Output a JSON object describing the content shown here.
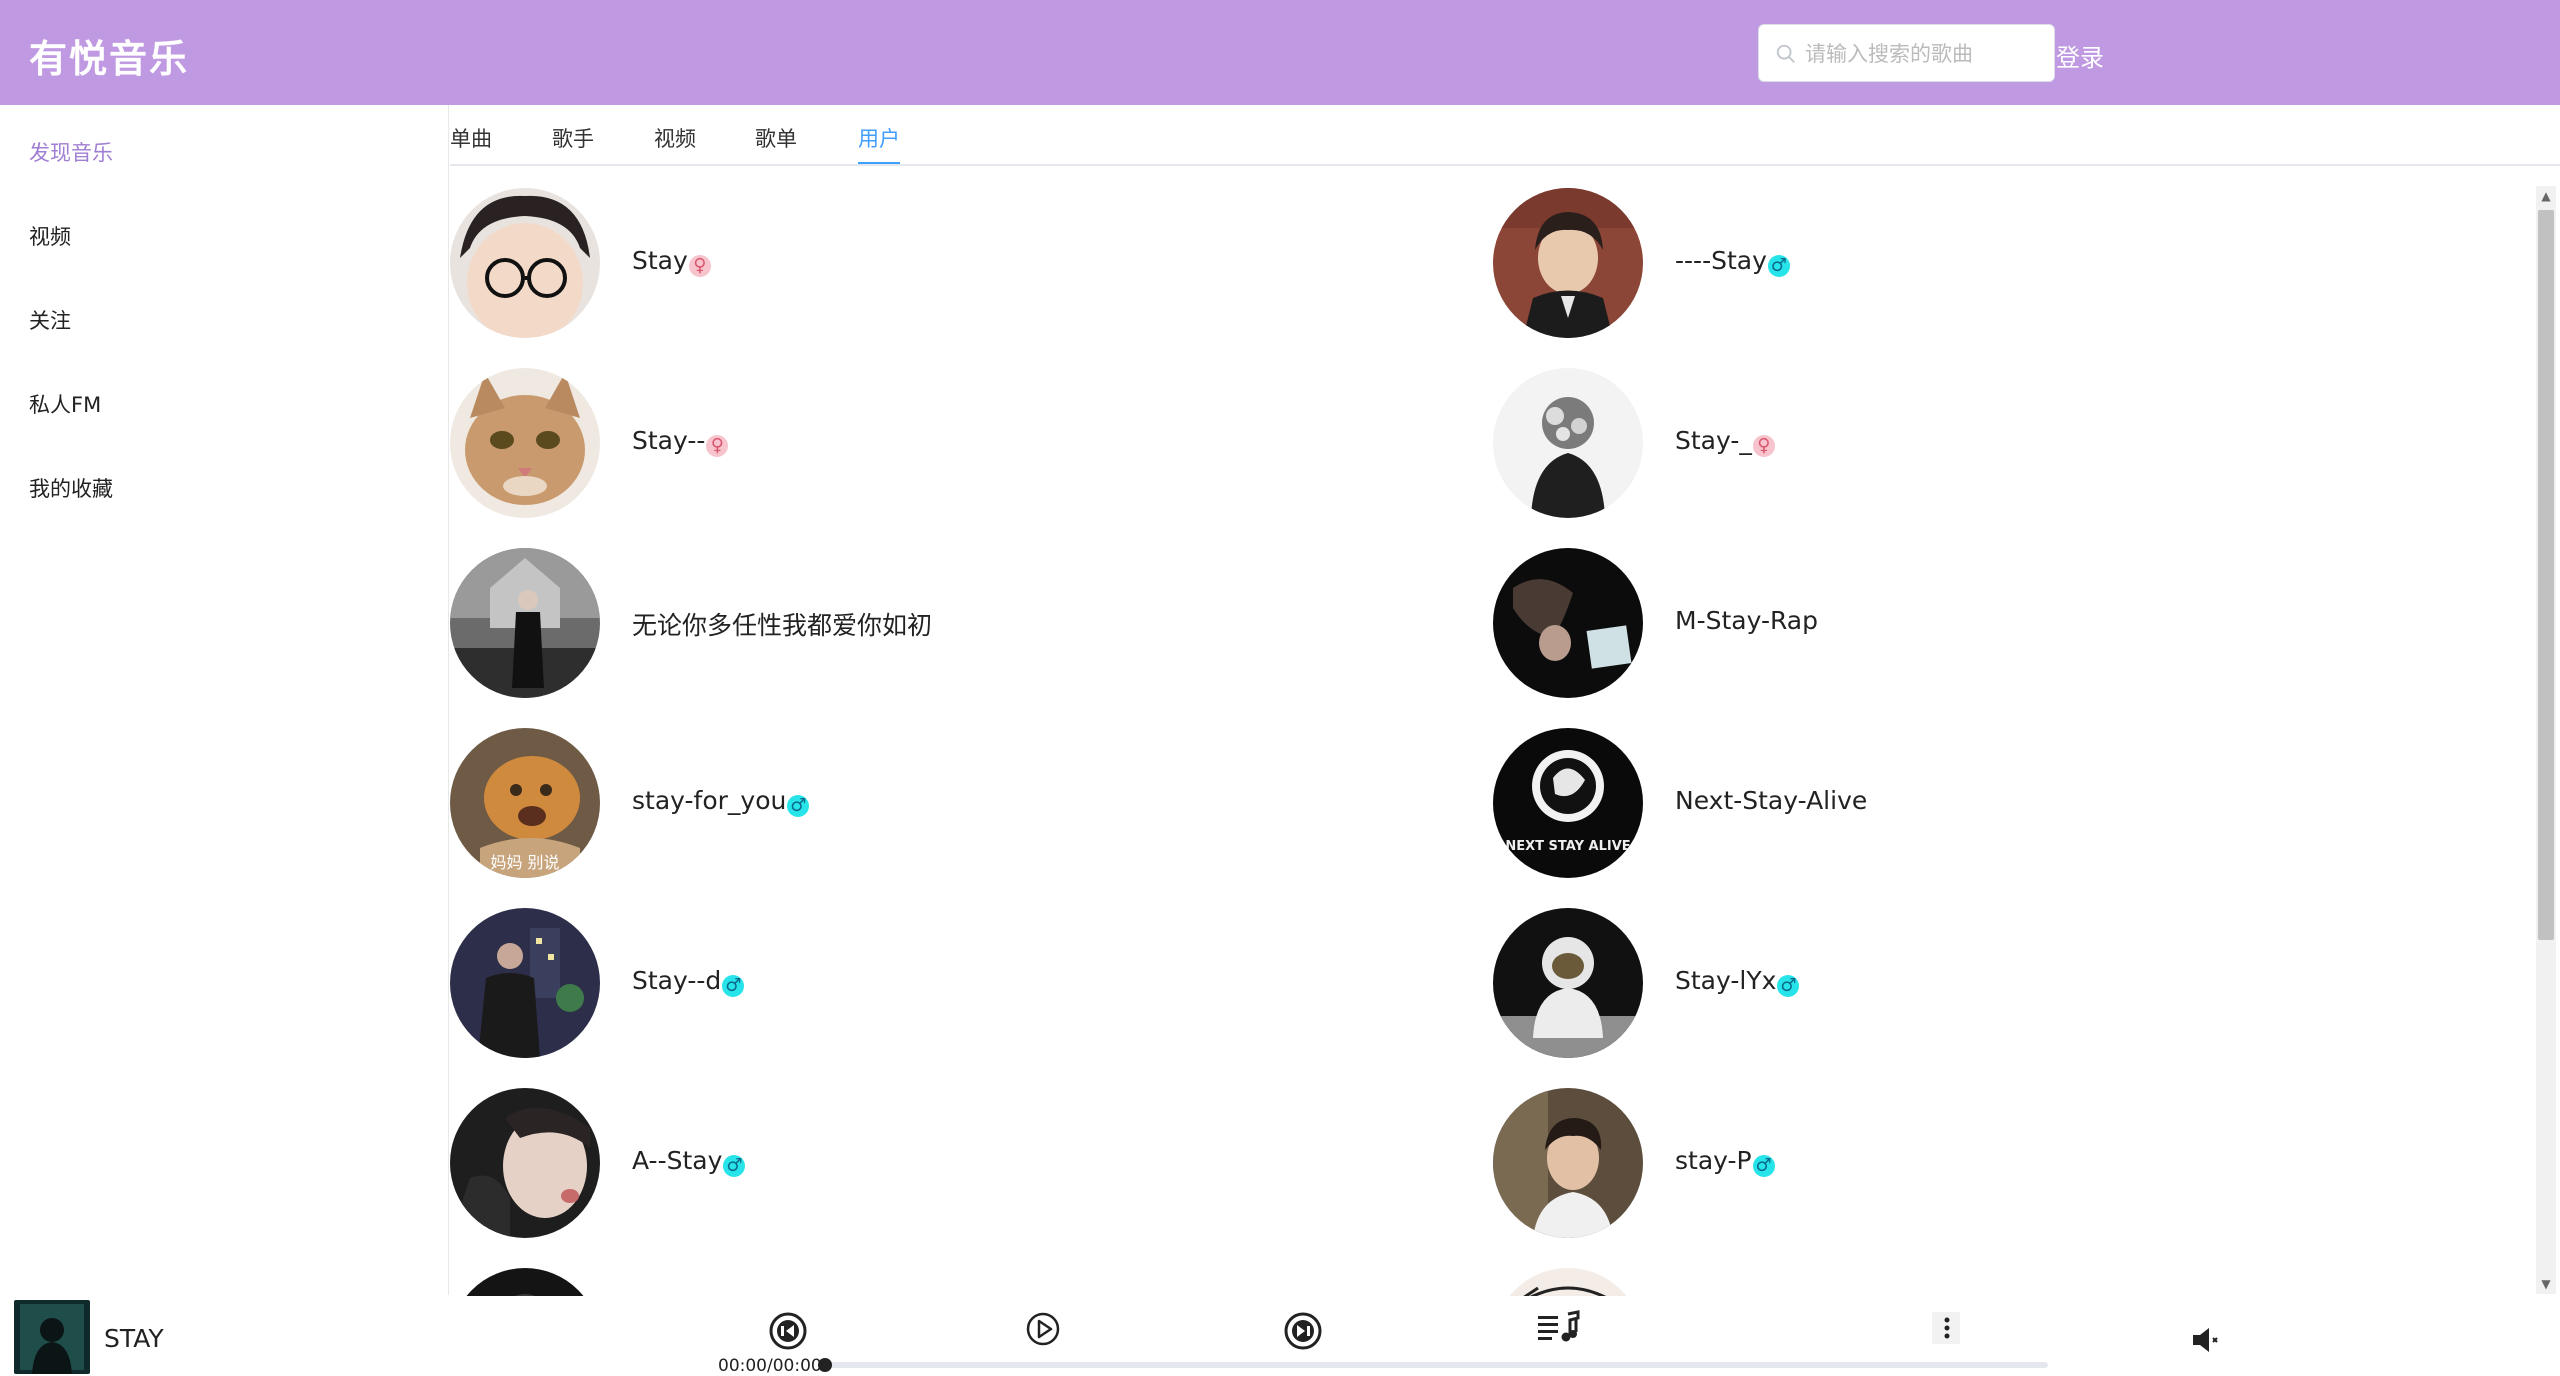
{
  "header": {
    "brand": "有悦音乐",
    "search_placeholder": "请输入搜索的歌曲",
    "search_value": "",
    "login_label": "登录",
    "bg_color": "#bf99e1"
  },
  "sidebar": {
    "items": [
      {
        "label": "发现音乐",
        "active": true
      },
      {
        "label": "视频",
        "active": false
      },
      {
        "label": "关注",
        "active": false
      },
      {
        "label": "私人FM",
        "active": false
      },
      {
        "label": "我的收藏",
        "active": false
      }
    ],
    "active_color": "#a07ed3"
  },
  "tabs": {
    "items": [
      "单曲",
      "歌手",
      "视频",
      "歌单",
      "用户"
    ],
    "active_index": 4,
    "active_color": "#409eff"
  },
  "users": [
    {
      "name": "Stay",
      "gender": "female",
      "gender_symbol": "♀"
    },
    {
      "name": "----Stay",
      "gender": "male",
      "gender_symbol": "♂"
    },
    {
      "name": "Stay--",
      "gender": "female",
      "gender_symbol": "♀"
    },
    {
      "name": "Stay-_",
      "gender": "female",
      "gender_symbol": "♀"
    },
    {
      "name": "无论你多任性我都爱你如初",
      "gender": "none",
      "gender_symbol": ""
    },
    {
      "name": "M-Stay-Rap",
      "gender": "none",
      "gender_symbol": ""
    },
    {
      "name": "stay-for_you",
      "gender": "male",
      "gender_symbol": "♂"
    },
    {
      "name": "Next-Stay-Alive",
      "gender": "none",
      "gender_symbol": ""
    },
    {
      "name": "Stay--d",
      "gender": "male",
      "gender_symbol": "♂"
    },
    {
      "name": "Stay-lYx",
      "gender": "male",
      "gender_symbol": "♂"
    },
    {
      "name": "A--Stay",
      "gender": "male",
      "gender_symbol": "♂"
    },
    {
      "name": "stay-P",
      "gender": "male",
      "gender_symbol": "♂"
    }
  ],
  "avatar_overlay_texts": {
    "cat_caption": "妈妈 别说",
    "alive_caption": "NEXT STAY ALIVE"
  },
  "player": {
    "song_title": "STAY",
    "time_display": "00:00/00:00",
    "progress": 0.0,
    "icons": {
      "prev": "prev-track-icon",
      "play": "play-icon",
      "next": "next-track-icon",
      "playlist": "playlist-icon",
      "more": "more-vertical-icon",
      "volume": "volume-mute-icon"
    }
  }
}
